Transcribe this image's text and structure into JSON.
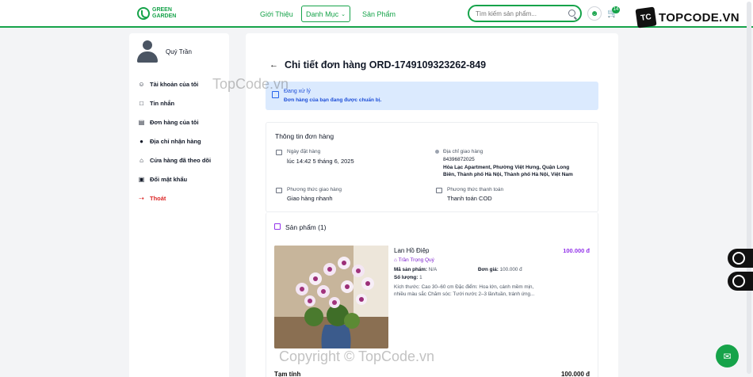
{
  "header": {
    "logo_line1": "GREEN",
    "logo_line2": "GARDEN",
    "nav_about": "Giới Thiệu",
    "nav_category": "Danh Mục",
    "nav_products": "Sản Phẩm",
    "search_placeholder": "Tìm kiếm sản phẩm...",
    "cart_count": "14"
  },
  "brand": {
    "logo": "TC",
    "text": "TOPCODE.VN"
  },
  "sidebar": {
    "user_name": "Quý Trần",
    "items": [
      {
        "label": "Tài khoản của tôi",
        "icon": "user-icon"
      },
      {
        "label": "Tin nhắn",
        "icon": "message-icon"
      },
      {
        "label": "Đơn hàng của tôi",
        "icon": "order-icon"
      },
      {
        "label": "Địa chỉ nhận hàng",
        "icon": "location-icon"
      },
      {
        "label": "Cửa hàng đã theo dõi",
        "icon": "store-icon"
      },
      {
        "label": "Đổi mật khẩu",
        "icon": "lock-icon"
      },
      {
        "label": "Thoát",
        "icon": "logout-icon"
      }
    ]
  },
  "order": {
    "title": "Chi tiết đơn hàng ORD-1749109323262-849",
    "status_title": "Đang xử lý",
    "status_desc": "Đơn hàng của bạn đang được chuẩn bị.",
    "info_heading": "Thông tin đơn hàng",
    "date_label": "Ngày đặt hàng",
    "date_value": "lúc 14:42 5 tháng 6, 2025",
    "address_label": "Địa chỉ giao hàng",
    "address_phone": "84396872025",
    "address_line1": "Hòa Lạc Apartment, Phường Việt Hưng, Quận Long",
    "address_line2": "Biên, Thành phố Hà Nội, Thành phố Hà Nội, Việt Nam",
    "shipping_label": "Phương thức giao hàng",
    "shipping_value": "Giao hàng nhanh",
    "payment_label": "Phương thức thanh toán",
    "payment_value": "Thanh toán COD",
    "products_heading": "Sản phẩm (1)",
    "product": {
      "name": "Lan Hồ Điệp",
      "price": "100.000 đ",
      "shop": "Trần Trọng Quý",
      "sku_label": "Mã sản phẩm:",
      "sku_value": "N/A",
      "unit_price_label": "Đơn giá:",
      "unit_price_value": "100.000 đ",
      "qty_label": "Số lượng:",
      "qty_value": "1",
      "desc_line1": "Kích thước: Cao 30–60 cm Đặc điểm: Hoa lớn, cánh mềm mịn,",
      "desc_line2": "nhiều màu sắc Chăm sóc: Tưới nước 2–3 lần/tuần, tránh ứng..."
    },
    "subtotal_label": "Tạm tính",
    "subtotal_value": "100.000 đ"
  },
  "watermarks": {
    "top": "TopCode.vn",
    "bottom": "Copyright © TopCode.vn"
  },
  "colors": {
    "primary": "#16a34a",
    "status_bg": "#dbeafe",
    "price": "#9333ea"
  }
}
